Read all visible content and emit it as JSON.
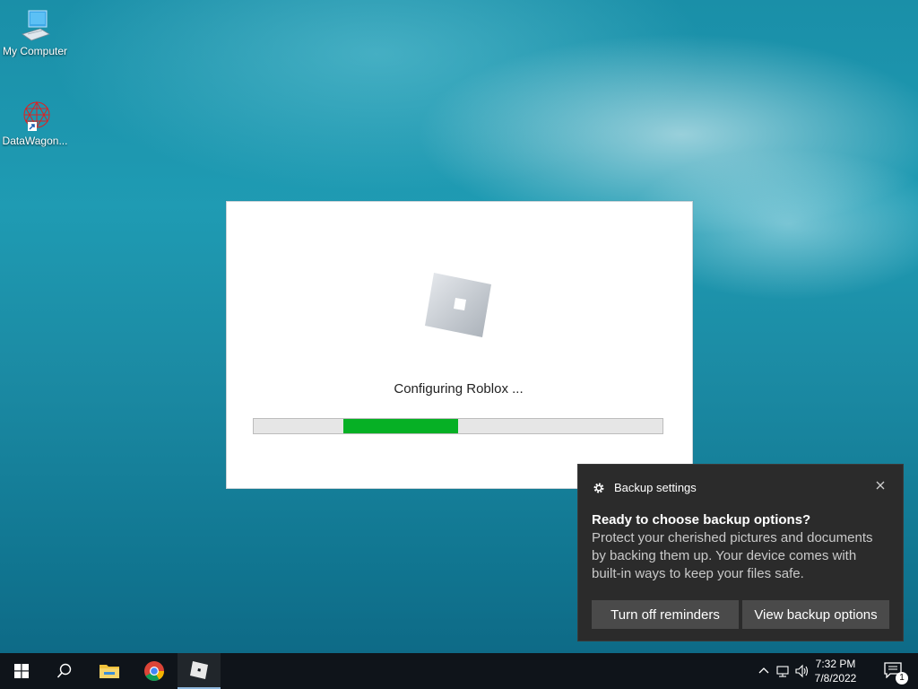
{
  "desktop": {
    "icons": [
      {
        "label": "My Computer",
        "icon": "computer-icon"
      },
      {
        "label": "DataWagon...",
        "icon": "datawagon-shortcut-icon"
      }
    ]
  },
  "installer": {
    "status": "Configuring Roblox ...",
    "progress_start": 0.22,
    "progress_end": 0.5,
    "progress_color": "#06b025"
  },
  "toast": {
    "app": "Backup settings",
    "title": "Ready to choose backup options?",
    "body": "Protect your cherished pictures and documents by backing them up. Your device comes with built-in ways to keep your files safe.",
    "buttons": {
      "turn_off": "Turn off reminders",
      "view": "View backup options"
    }
  },
  "taskbar": {
    "items": [
      "start-icon",
      "search-icon",
      "file-explorer-icon",
      "chrome-icon",
      "roblox-icon"
    ],
    "clock": {
      "time": "7:32 PM",
      "date": "7/8/2022"
    },
    "notification_count": "1"
  }
}
